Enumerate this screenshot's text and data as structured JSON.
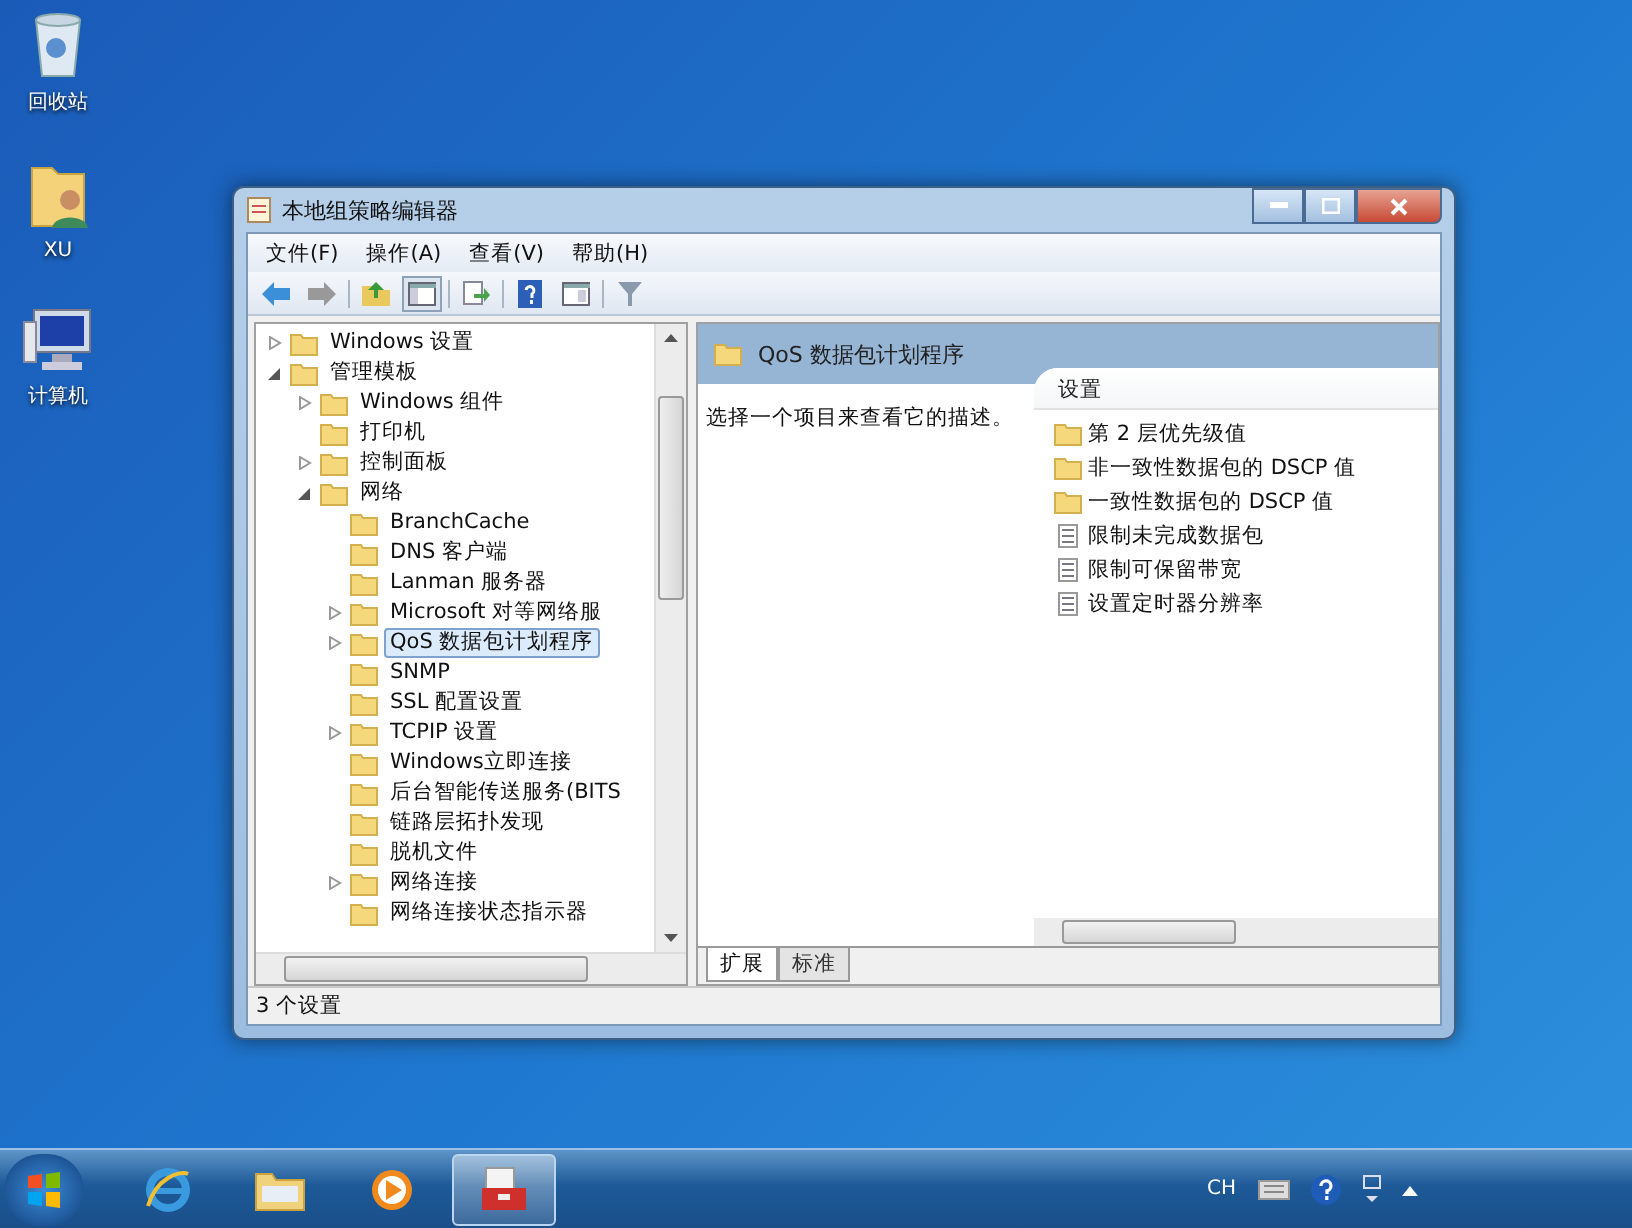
{
  "desktop": {
    "icons": [
      {
        "kind": "recycle",
        "label": "回收站"
      },
      {
        "kind": "user",
        "label": "XU"
      },
      {
        "kind": "computer",
        "label": "计算机"
      }
    ]
  },
  "window": {
    "title": "本地组策略编辑器",
    "menu": [
      "文件(F)",
      "操作(A)",
      "查看(V)",
      "帮助(H)"
    ]
  },
  "tree": [
    {
      "label": "Windows 设置",
      "expanded": false,
      "selected": false
    },
    {
      "label": "管理模板",
      "expanded": true,
      "selected": false,
      "children": [
        {
          "label": "Windows 组件",
          "expanded": false,
          "selected": false
        },
        {
          "label": "打印机",
          "selected": false
        },
        {
          "label": "控制面板",
          "expanded": false,
          "selected": false
        },
        {
          "label": "网络",
          "expanded": true,
          "selected": false,
          "children": [
            {
              "label": "BranchCache",
              "selected": false
            },
            {
              "label": "DNS 客户端",
              "selected": false
            },
            {
              "label": "Lanman 服务器",
              "selected": false
            },
            {
              "label": "Microsoft 对等网络服",
              "expanded": false,
              "selected": false
            },
            {
              "label": "QoS 数据包计划程序",
              "expanded": false,
              "selected": true
            },
            {
              "label": "SNMP",
              "selected": false
            },
            {
              "label": "SSL 配置设置",
              "selected": false
            },
            {
              "label": "TCPIP 设置",
              "expanded": false,
              "selected": false
            },
            {
              "label": "Windows立即连接",
              "selected": false
            },
            {
              "label": "后台智能传送服务(BITS",
              "selected": false
            },
            {
              "label": "链路层拓扑发现",
              "selected": false
            },
            {
              "label": "脱机文件",
              "selected": false
            },
            {
              "label": "网络连接",
              "expanded": false,
              "selected": false
            },
            {
              "label": "网络连接状态指示器",
              "selected": false
            }
          ]
        }
      ]
    }
  ],
  "detail": {
    "title": "QoS 数据包计划程序",
    "description": "选择一个项目来查看它的描述。",
    "column": "设置",
    "items": [
      {
        "kind": "folder",
        "label": "第 2 层优先级值"
      },
      {
        "kind": "folder",
        "label": "非一致性数据包的 DSCP 值"
      },
      {
        "kind": "folder",
        "label": "一致性数据包的 DSCP 值"
      },
      {
        "kind": "setting",
        "label": "限制未完成数据包"
      },
      {
        "kind": "setting",
        "label": "限制可保留带宽"
      },
      {
        "kind": "setting",
        "label": "设置定时器分辨率"
      }
    ]
  },
  "tabs": [
    {
      "label": "扩展",
      "selected": true
    },
    {
      "label": "标准",
      "selected": false
    }
  ],
  "status_bar": "3 个设置",
  "taskbar": {
    "apps": [
      {
        "kind": "browser",
        "selected": false
      },
      {
        "kind": "folder",
        "selected": false
      },
      {
        "kind": "media",
        "selected": false
      },
      {
        "kind": "toolbox",
        "selected": true
      }
    ],
    "language": "CH"
  }
}
